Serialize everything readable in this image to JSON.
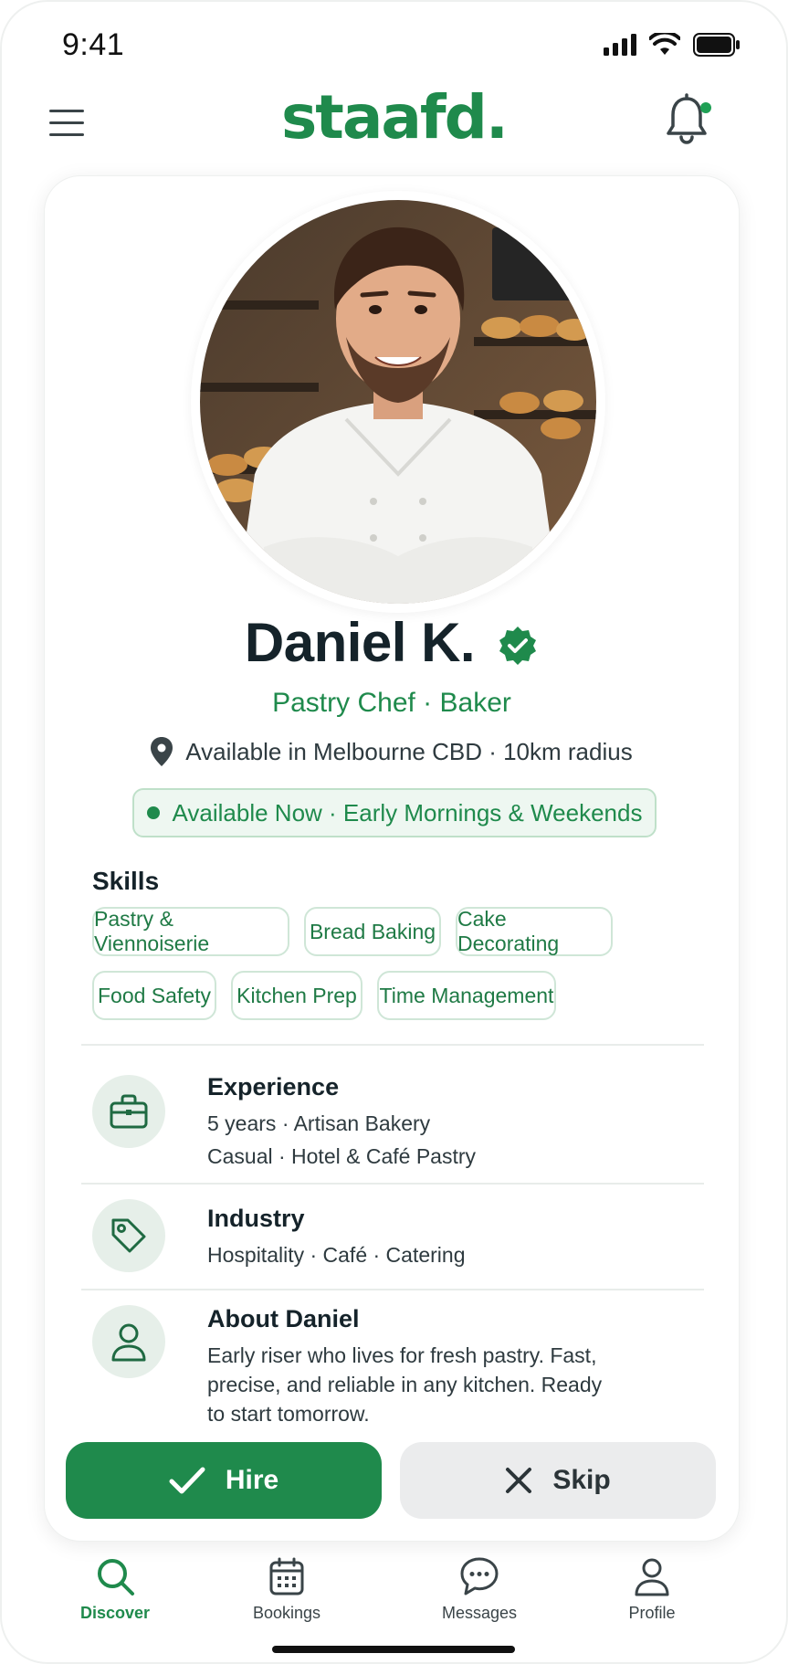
{
  "status_bar": {
    "time": "9:41"
  },
  "header": {
    "logo": "staafd."
  },
  "profile": {
    "name": "Daniel K.",
    "roles": "Pastry Chef · Baker",
    "location": "Available in Melbourne CBD · 10km radius",
    "availability": "Available Now · Early Mornings & Weekends"
  },
  "skills": {
    "title": "Skills",
    "items": [
      "Pastry & Viennoiserie",
      "Bread Baking",
      "Cake Decorating",
      "Food Safety",
      "Kitchen Prep",
      "Time Management"
    ]
  },
  "experience": {
    "title": "Experience",
    "line1": "5 years · Artisan Bakery",
    "line2": "Casual · Hotel & Café Pastry"
  },
  "industry": {
    "title": "Industry",
    "line1": "Hospitality · Café · Catering"
  },
  "about": {
    "title": "About Daniel",
    "line1": "Early riser who lives for fresh pastry. Fast,",
    "line2": "precise, and reliable in any kitchen. Ready",
    "line3": "to start tomorrow."
  },
  "actions": {
    "hire_label": "Hire",
    "skip_label": "Skip"
  },
  "nav": {
    "items": [
      {
        "label": "Discover",
        "icon": "search-icon",
        "active": true
      },
      {
        "label": "Bookings",
        "icon": "calendar-icon",
        "active": false
      },
      {
        "label": "Messages",
        "icon": "chat-icon",
        "active": false
      },
      {
        "label": "Profile",
        "icon": "user-icon",
        "active": false
      }
    ]
  },
  "colors": {
    "brand": "#1f8a4c",
    "skip_bg": "#ebeced",
    "chip_border": "#cfe6d7"
  }
}
